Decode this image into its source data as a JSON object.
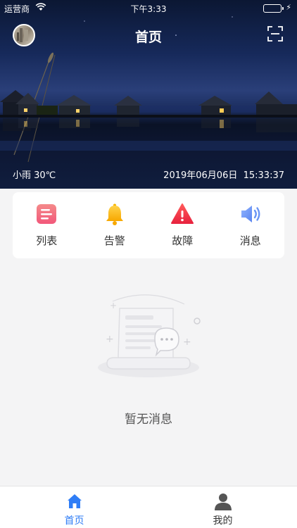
{
  "status_bar": {
    "carrier": "运营商",
    "time": "下午3:33",
    "battery_color": "#3fd04a"
  },
  "header": {
    "title": "首页",
    "avatar_icon": "avatar",
    "scan_icon": "scan-icon"
  },
  "hero": {
    "weather": "小雨 30℃",
    "date": "2019年06月06日",
    "time": "15:33:37"
  },
  "quick_menu": {
    "items": [
      {
        "label": "列表",
        "icon": "list-icon",
        "color": "#f26b7d"
      },
      {
        "label": "告警",
        "icon": "bell-icon",
        "color": "#f7b500"
      },
      {
        "label": "故障",
        "icon": "warning-icon",
        "color": "#f23b4f"
      },
      {
        "label": "消息",
        "icon": "speaker-icon",
        "color": "#6a96f5"
      }
    ]
  },
  "empty_state": {
    "message": "暂无消息",
    "icon": "empty-message-illustration"
  },
  "tab_bar": {
    "active_color": "#2f7df6",
    "tabs": [
      {
        "label": "首页",
        "icon": "home-icon",
        "active": true
      },
      {
        "label": "我的",
        "icon": "user-icon",
        "active": false
      }
    ]
  }
}
